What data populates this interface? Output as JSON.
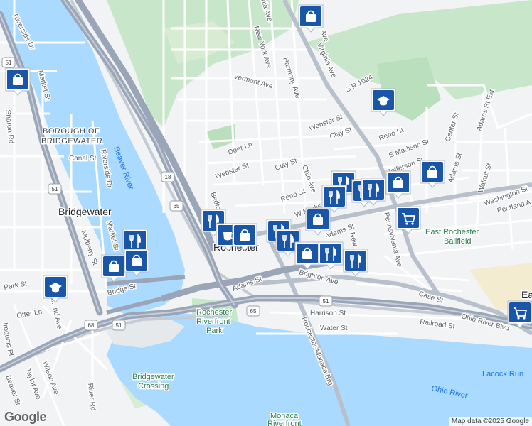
{
  "colors": {
    "land": "#f1f3f4",
    "park": "#c8e6c9",
    "water": "#aadaff",
    "highway": "#9aa6b8",
    "road": "#ffffff",
    "rail": "#c5cbd3",
    "pin": "#1a56a8"
  },
  "labels": {
    "borough": "BOROUGH OF",
    "borough2": "BRIDGEWATER",
    "bridgewater": "Bridgewater",
    "rochester": "Rochester",
    "east_rochester_ballfield": "East Rochester",
    "east_rochester_ballfield2": "Ballfield",
    "riverfront_park": "Rochester",
    "riverfront_park2": "Riverfront",
    "riverfront_park3": "Park",
    "bridgewater_crossing": "Bridgewater",
    "bridgewater_crossing2": "Crossing",
    "monaca_riverfront": "Monaca",
    "monaca_riverfront2": "Riverfront",
    "lacock_run": "Lacock Run",
    "ohio_river": "Ohio River",
    "beaver_river": "Beaver River",
    "east_partial": "Ea"
  },
  "streets": {
    "riverside_dr_nw": "Riverside Dr",
    "market_st_n": "Market St",
    "sharon_rd": "Sharon Rd",
    "market_st_w": "Market St",
    "canal_st": "Canal St",
    "riverside_dr_s": "Riverside Dr",
    "mulberry_st": "Mulberry St",
    "park_st": "Park St",
    "otter_ln": "Otter Ln",
    "iroquois_pl": "Iroquois Pl",
    "fayette_ave": "Fa... nd Ave",
    "bridge_st": "Bridge St",
    "wilson_ave": "Wilson Ave",
    "taylor_ave": "Taylor Ave",
    "beaver_st": "Beaver St",
    "river_rd": "River Rd",
    "new_york_ave": "New York Ave",
    "vermont_ave": "Vermont Ave",
    "harmony_ave": "Harmony Ave",
    "virginia_ave": "Virginia Ave",
    "sr_1024": "S R 1024",
    "webster_st_e": "Webster St",
    "clay_st_e": "Clay St",
    "deer_ln": "Deer Ln",
    "webster_st": "Webster St",
    "clay_st": "Clay St",
    "ohio_ave": "Ohio Ave",
    "reno_st": "Reno St",
    "w_madison": "W Madis",
    "bedford": "Bedfo",
    "adams_st": "Adams St",
    "adams_st_w": "Adams St",
    "brighton_ave": "Brighton Ave",
    "reno_st_e": "Reno St",
    "e_madison_st": "E Madison St",
    "jefferson_st": "Jefferson St",
    "center_st": "Center St",
    "adams_st_ext": "Adams St Ext",
    "adams_st_e": "Adams St",
    "walnut_st": "Walnut St",
    "washington_st": "Washington St",
    "pentland": "Pentland A",
    "pennsylvania_ave": "Pennsylvania Ave",
    "new_ave": "New",
    "case_st": "Case St",
    "harrison_st": "Harrison St",
    "railroad_st": "Railroad St",
    "water_st": "Water St",
    "ohio_river_blvd": "Ohio River Blvd",
    "rochester_monaca_brg": "Rochester-Monaca Brg",
    "avia_ave": "nia Ave",
    "ave_top": "Ave"
  },
  "shields": [
    "51",
    "51",
    "18",
    "65",
    "65",
    "51",
    "68",
    "51"
  ],
  "pins": [
    {
      "type": "shopping",
      "icon": "shopping-bag-icon"
    },
    {
      "type": "shopping",
      "icon": "shopping-bag-icon"
    },
    {
      "type": "school",
      "icon": "graduation-cap-icon"
    },
    {
      "type": "restaurant",
      "icon": "fork-knife-icon"
    },
    {
      "type": "restaurant",
      "icon": "fork-knife-icon"
    },
    {
      "type": "shopping",
      "icon": "shopping-bag-icon"
    },
    {
      "type": "shopping",
      "icon": "shopping-bag-icon"
    },
    {
      "type": "restaurant",
      "icon": "fork-knife-icon"
    },
    {
      "type": "restaurant",
      "icon": "fork-knife-icon"
    },
    {
      "type": "shopping",
      "icon": "shopping-bag-icon"
    },
    {
      "type": "cart",
      "icon": "shopping-cart-icon"
    },
    {
      "type": "restaurant",
      "icon": "fork-knife-icon"
    },
    {
      "type": "cafe",
      "icon": "coffee-cup-icon"
    },
    {
      "type": "shopping",
      "icon": "shopping-bag-icon"
    },
    {
      "type": "restaurant",
      "icon": "fork-knife-icon"
    },
    {
      "type": "restaurant",
      "icon": "fork-knife-icon"
    },
    {
      "type": "shopping",
      "icon": "shopping-bag-icon"
    },
    {
      "type": "restaurant",
      "icon": "fork-knife-icon"
    },
    {
      "type": "restaurant",
      "icon": "fork-knife-icon"
    },
    {
      "type": "shopping",
      "icon": "shopping-bag-icon"
    },
    {
      "type": "restaurant",
      "icon": "fork-knife-icon"
    },
    {
      "type": "shopping",
      "icon": "shopping-bag-icon"
    },
    {
      "type": "school",
      "icon": "graduation-cap-icon"
    },
    {
      "type": "cart",
      "icon": "shopping-cart-icon"
    }
  ],
  "footer": {
    "logo": "Google",
    "attribution": "Map data ©2025 Google"
  }
}
